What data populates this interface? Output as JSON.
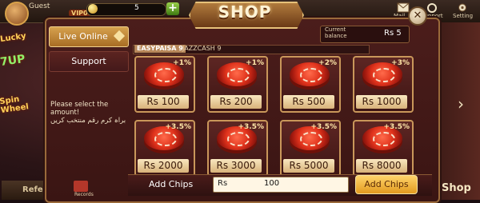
{
  "topbar": {
    "username": "Guest",
    "vip": "VIP0",
    "chips": "5",
    "icons": [
      {
        "name": "mail-icon",
        "label": "Mail"
      },
      {
        "name": "support-icon",
        "label": "Support"
      },
      {
        "name": "setting-icon",
        "label": "Setting"
      }
    ]
  },
  "side": {
    "promos": [
      "Lucky",
      "7UP",
      "Spin Wheel"
    ],
    "refer_label": "Refe",
    "shop_label": "Shop"
  },
  "shop": {
    "title": "SHOP",
    "tabs": [
      {
        "label": "Live Online",
        "active": true
      },
      {
        "label": "Support",
        "active": false
      }
    ],
    "select_note_en": "Please select the amount!",
    "select_note_ur": "براہ کرم رقم منتخب کریں",
    "balance_label": "Current balance",
    "balance_value": "Rs  5",
    "methods": [
      "EASYPAISA 9",
      "JAZZCASH 9"
    ],
    "packages": [
      {
        "price": "Rs 100",
        "bonus": "+1%"
      },
      {
        "price": "Rs 200",
        "bonus": "+1%"
      },
      {
        "price": "Rs 500",
        "bonus": "+2%"
      },
      {
        "price": "Rs 1000",
        "bonus": "+3%"
      },
      {
        "price": "Rs 2000",
        "bonus": "+3.5%"
      },
      {
        "price": "Rs 3000",
        "bonus": "+3.5%"
      },
      {
        "price": "Rs 5000",
        "bonus": "+3.5%"
      },
      {
        "price": "Rs 8000",
        "bonus": "+3.5%"
      }
    ],
    "add_chips_label": "Add Chips",
    "currency": "Rs",
    "amount": "100",
    "add_button": "Add Chips",
    "records_label": "Records"
  },
  "colors": {
    "accent": "#e29a1f",
    "panel": "#4b1d1b",
    "border": "#c9975a"
  }
}
